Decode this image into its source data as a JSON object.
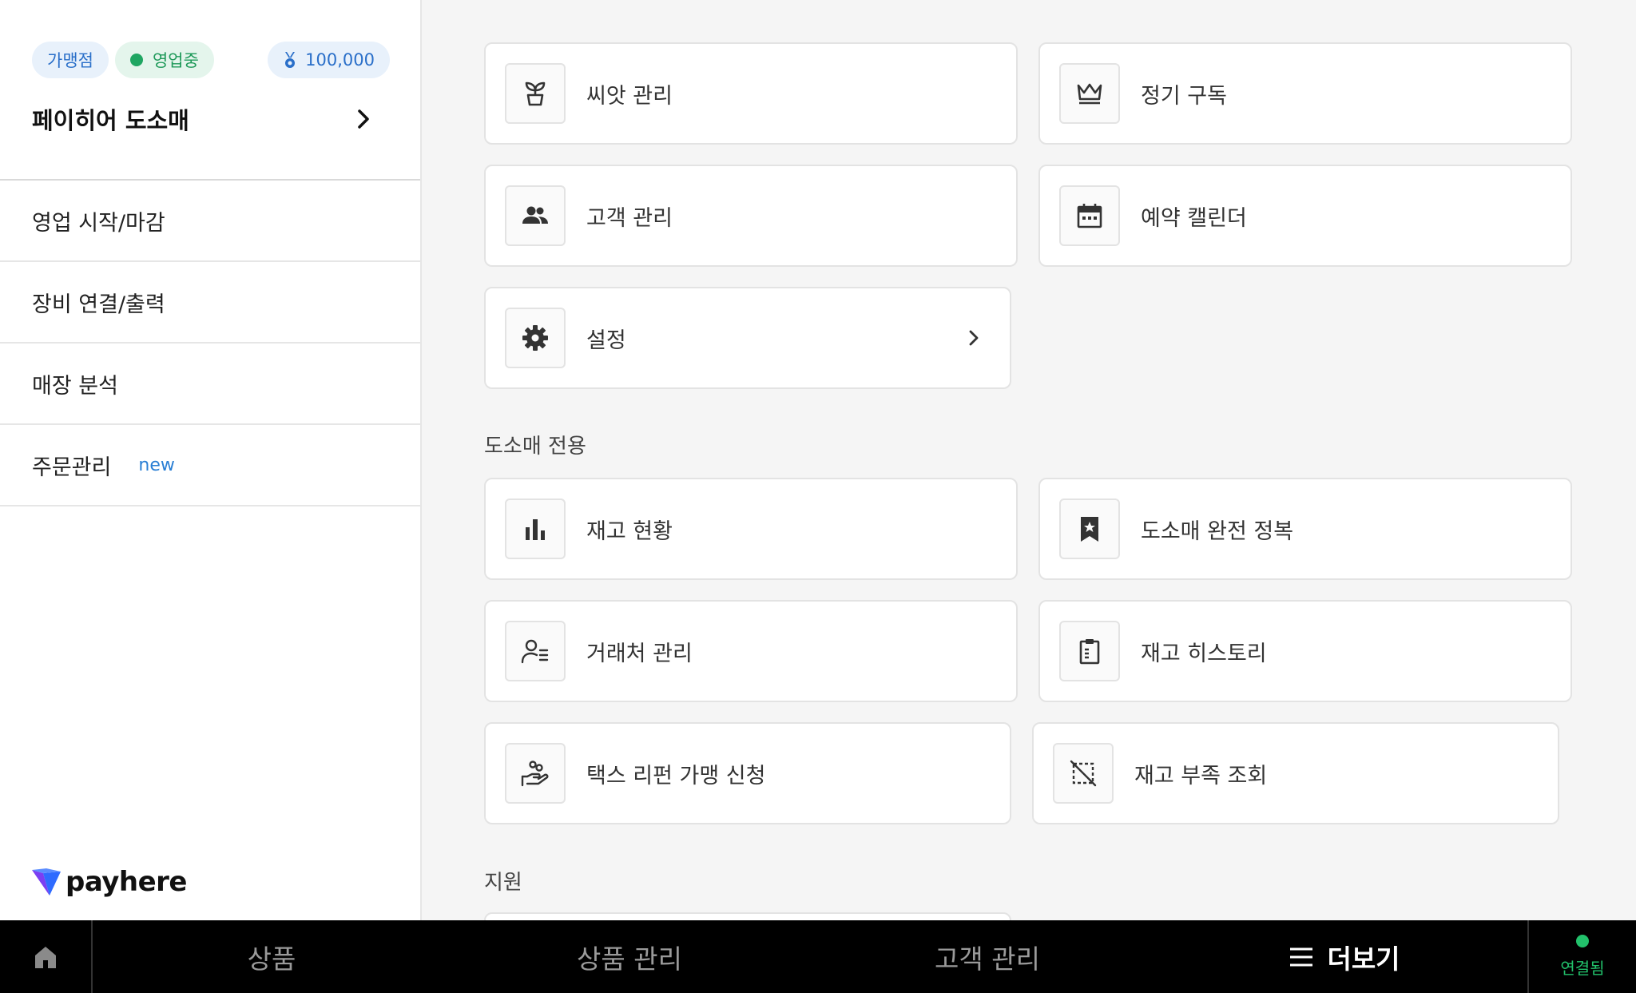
{
  "sidebar": {
    "badges": {
      "franchise": "가맹점",
      "status": "영업중",
      "points": "100,000"
    },
    "store_name": "페이히어 도소매",
    "menu": [
      {
        "label": "영업 시작/마감"
      },
      {
        "label": "장비 연결/출력"
      },
      {
        "label": "매장 분석"
      },
      {
        "label": "주문관리",
        "tag": "new"
      }
    ],
    "logo_text": "payhere"
  },
  "main": {
    "cards_top": [
      {
        "label": "씨앗 관리",
        "icon": "sprout-icon"
      },
      {
        "label": "정기 구독",
        "icon": "crown-icon"
      },
      {
        "label": "고객 관리",
        "icon": "people-icon"
      },
      {
        "label": "예약 캘린더",
        "icon": "calendar-icon"
      },
      {
        "label": "설정",
        "icon": "gear-icon"
      }
    ],
    "section_wholesale": {
      "title": "도소매 전용",
      "cards": [
        {
          "label": "재고 현황",
          "icon": "bar-chart-icon"
        },
        {
          "label": "도소매 완전 정복",
          "icon": "bookmark-star-icon"
        },
        {
          "label": "거래처 관리",
          "icon": "contact-list-icon"
        },
        {
          "label": "재고 히스토리",
          "icon": "clipboard-icon"
        },
        {
          "label": "택스 리펀 가맹 신청",
          "icon": "hand-coins-icon"
        },
        {
          "label": "재고 부족 조회",
          "icon": "crop-off-icon"
        }
      ]
    },
    "section_support": {
      "title": "지원"
    }
  },
  "bottom_nav": {
    "tabs": [
      "상품",
      "상품 관리",
      "고객 관리"
    ],
    "more": "더보기",
    "connection": "연결됨"
  },
  "colors": {
    "accent_blue": "#2a6fc9",
    "open_green": "#1fa662",
    "connected_green": "#22c16b"
  }
}
